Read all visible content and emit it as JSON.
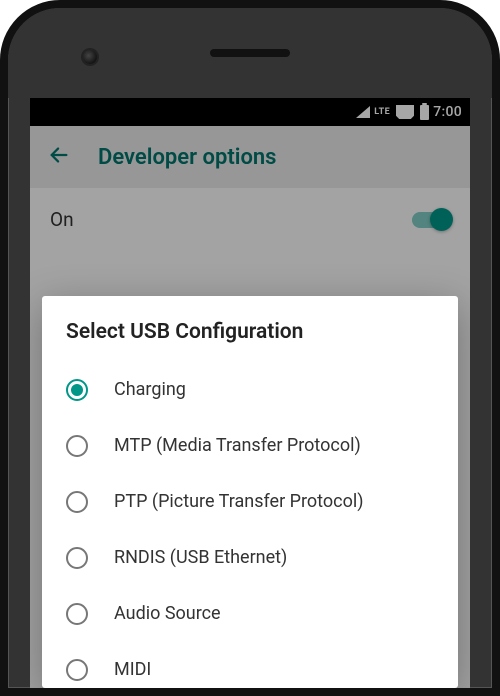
{
  "status": {
    "network_label": "LTE",
    "time": "7:00"
  },
  "appbar": {
    "title": "Developer options"
  },
  "toggle": {
    "label": "On",
    "state": true
  },
  "dialog": {
    "title": "Select USB Configuration",
    "options": [
      {
        "label": "Charging",
        "selected": true
      },
      {
        "label": "MTP (Media Transfer Protocol)",
        "selected": false
      },
      {
        "label": "PTP (Picture Transfer Protocol)",
        "selected": false
      },
      {
        "label": "RNDIS (USB Ethernet)",
        "selected": false
      },
      {
        "label": "Audio Source",
        "selected": false
      },
      {
        "label": "MIDI",
        "selected": false
      }
    ]
  },
  "colors": {
    "accent": "#009688",
    "appbar_text": "#00746b"
  }
}
